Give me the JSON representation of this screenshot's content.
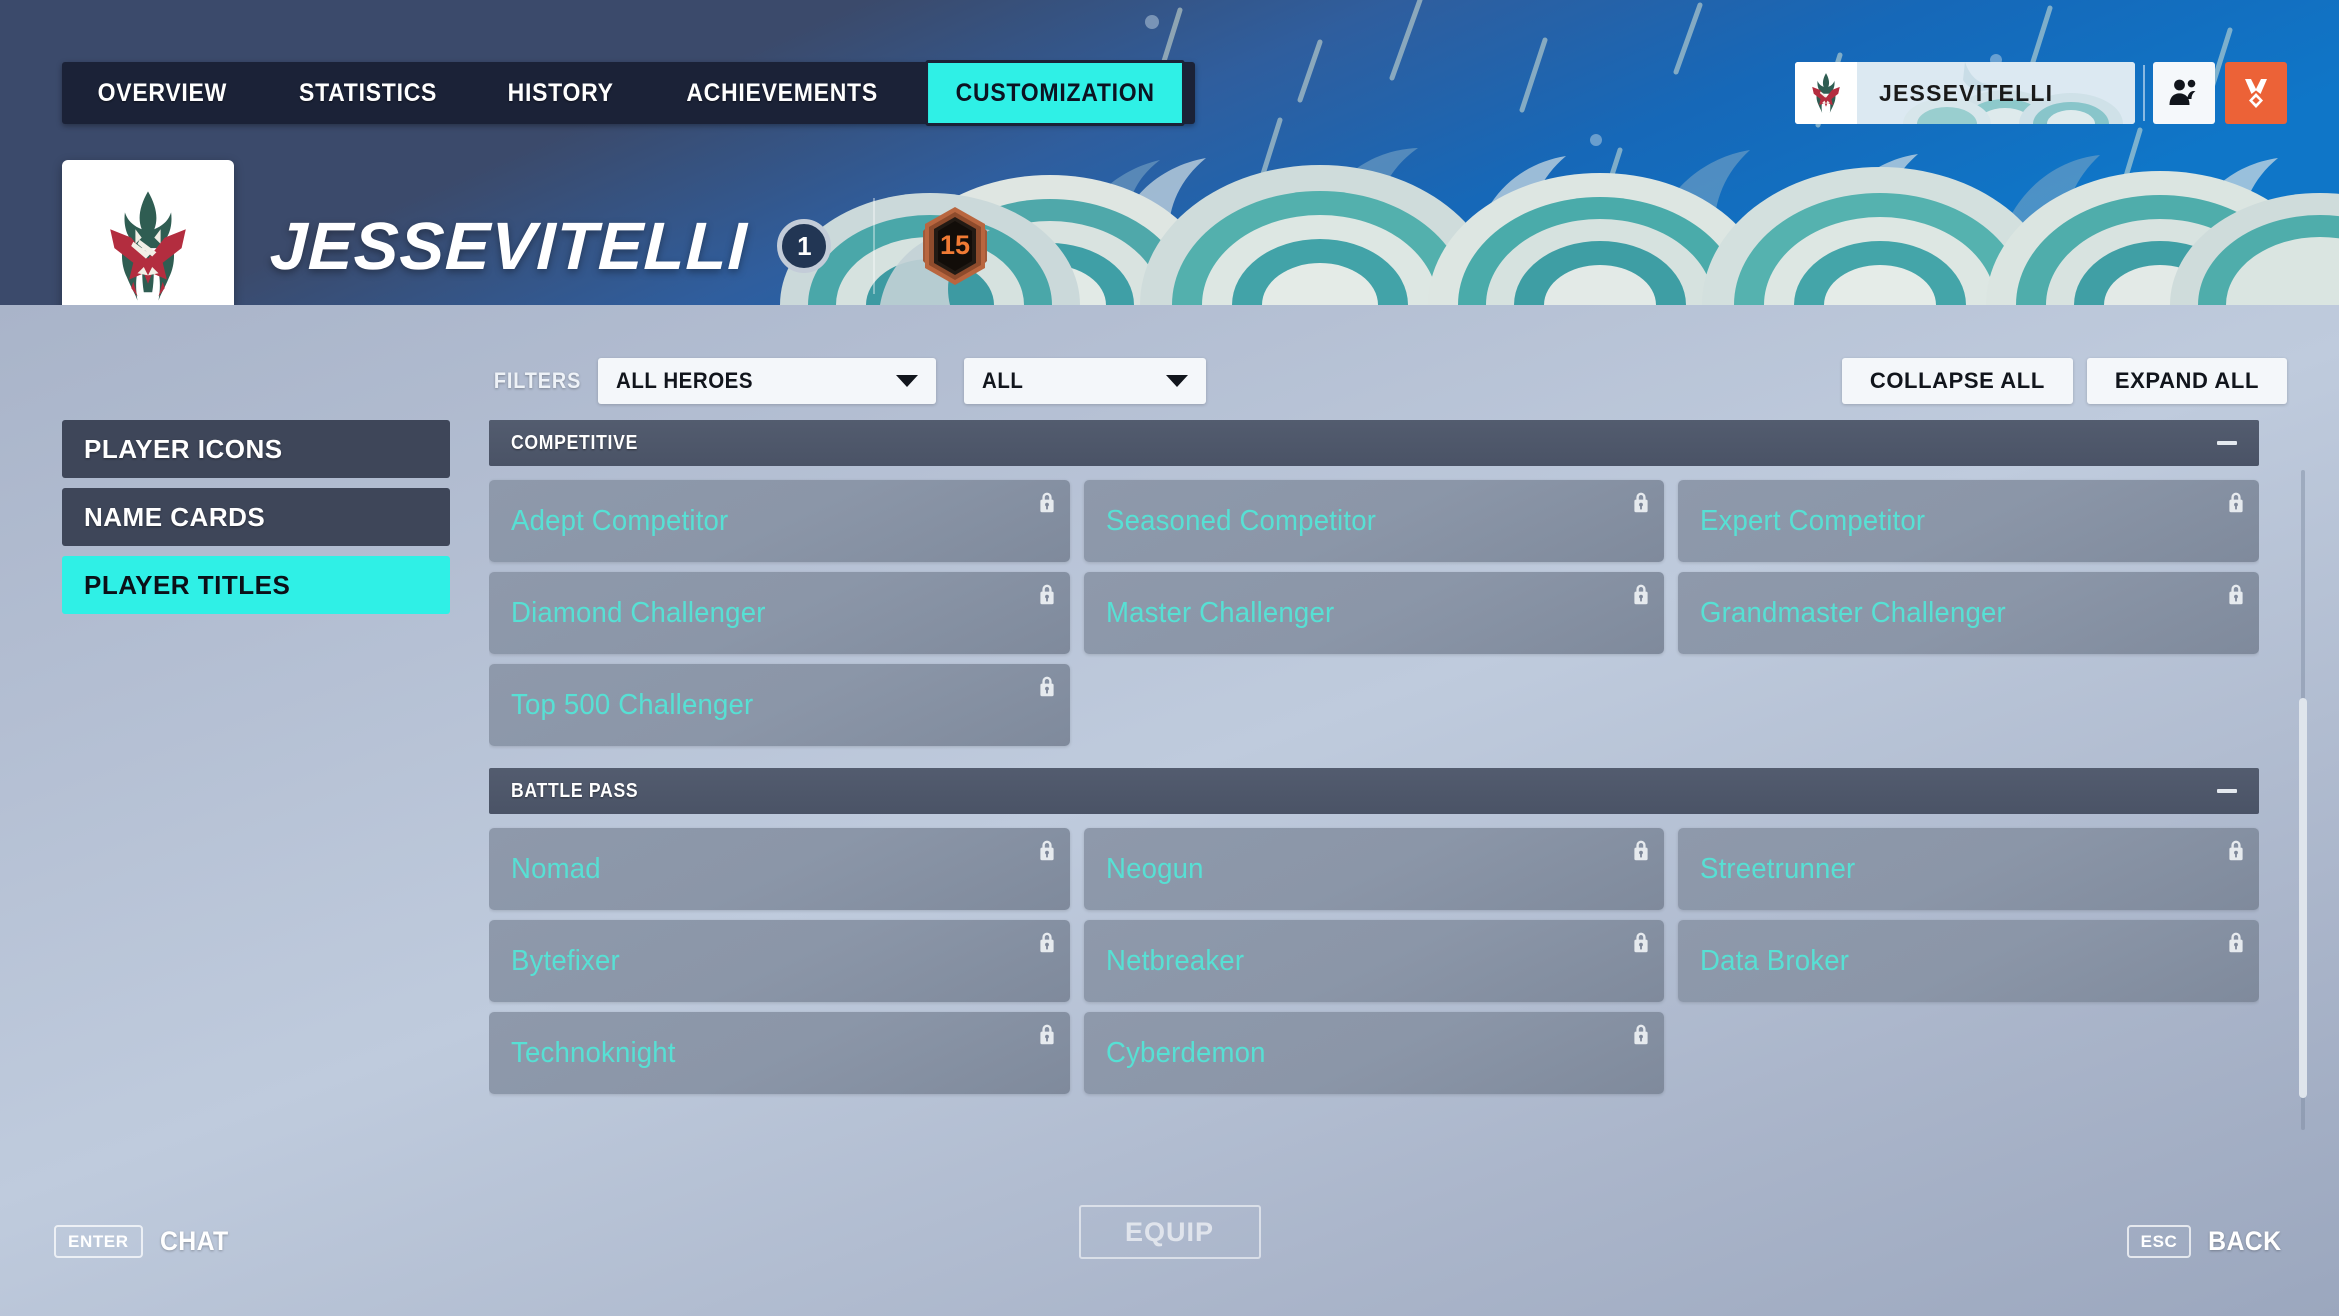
{
  "nav": {
    "tabs": [
      {
        "label": "OVERVIEW",
        "active": false
      },
      {
        "label": "STATISTICS",
        "active": false
      },
      {
        "label": "HISTORY",
        "active": false
      },
      {
        "label": "ACHIEVEMENTS",
        "active": false
      },
      {
        "label": "CUSTOMIZATION",
        "active": true
      }
    ]
  },
  "profile": {
    "player_name": "JESSEVITELLI",
    "level": "1",
    "endorsement_level": "15",
    "avatar_icon": "creature-mask-icon"
  },
  "topright": {
    "namecard_player": "JESSEVITELLI",
    "social_icon": "friends-icon",
    "achievements_icon": "medal-icon",
    "accent_orange": "#ec6237"
  },
  "filters": {
    "label": "FILTERS",
    "hero_filter_value": "ALL HEROES",
    "type_filter_value": "ALL",
    "collapse_all_label": "COLLAPSE ALL",
    "expand_all_label": "EXPAND ALL"
  },
  "sidebar": {
    "items": [
      {
        "label": "PLAYER ICONS",
        "active": false
      },
      {
        "label": "NAME CARDS",
        "active": false
      },
      {
        "label": "PLAYER TITLES",
        "active": true
      }
    ]
  },
  "sections": [
    {
      "title": "COMPETITIVE",
      "expanded": true,
      "items": [
        {
          "label": "Adept Competitor",
          "locked": true
        },
        {
          "label": "Seasoned Competitor",
          "locked": true
        },
        {
          "label": "Expert Competitor",
          "locked": true
        },
        {
          "label": "Diamond Challenger",
          "locked": true
        },
        {
          "label": "Master Challenger",
          "locked": true
        },
        {
          "label": "Grandmaster Challenger",
          "locked": true
        },
        {
          "label": "Top 500 Challenger",
          "locked": true
        }
      ]
    },
    {
      "title": "BATTLE PASS",
      "expanded": true,
      "items": [
        {
          "label": "Nomad",
          "locked": true
        },
        {
          "label": "Neogun",
          "locked": true
        },
        {
          "label": "Streetrunner",
          "locked": true
        },
        {
          "label": "Bytefixer",
          "locked": true
        },
        {
          "label": "Netbreaker",
          "locked": true
        },
        {
          "label": "Data Broker",
          "locked": true
        },
        {
          "label": "Technoknight",
          "locked": true
        },
        {
          "label": "Cyberdemon",
          "locked": true
        }
      ]
    }
  ],
  "footer": {
    "chat_key": "ENTER",
    "chat_label": "CHAT",
    "equip_label": "EQUIP",
    "back_key": "ESC",
    "back_label": "BACK"
  },
  "theme": {
    "accent_cyan": "#2ff0e6",
    "title_text": "#57e0d4",
    "panel_dark": "#3e4659",
    "section_head": "#4f586b"
  }
}
